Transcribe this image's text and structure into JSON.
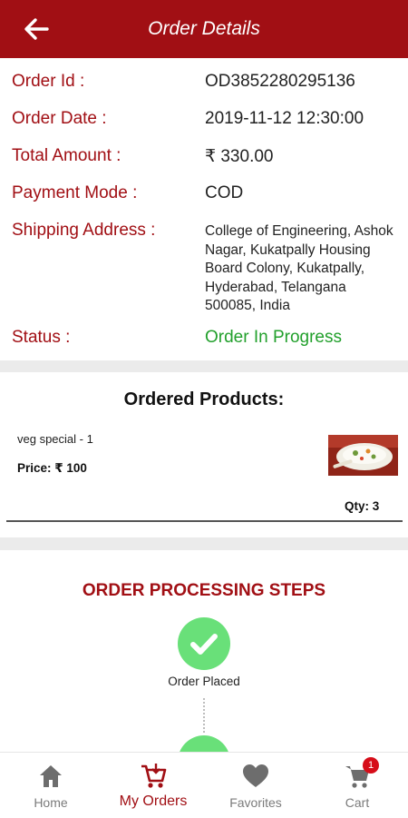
{
  "header": {
    "title": "Order Details"
  },
  "order": {
    "id_label": "Order Id :",
    "id_value": "OD3852280295136",
    "date_label": "Order Date :",
    "date_value": "2019-11-12 12:30:00",
    "amount_label": "Total Amount :",
    "amount_value": "₹ 330.00",
    "payment_label": "Payment Mode :",
    "payment_value": "COD",
    "address_label": "Shipping Address :",
    "address_value": "College of Engineering, Ashok Nagar, Kukatpally Housing Board Colony, Kukatpally, Hyderabad, Telangana 500085, India",
    "status_label": "Status :",
    "status_value": "Order In Progress"
  },
  "products": {
    "heading": "Ordered Products:",
    "items": [
      {
        "name": "veg special - 1",
        "price": "Price: ₹ 100",
        "qty": "Qty: 3"
      }
    ]
  },
  "steps": {
    "heading": "ORDER PROCESSING STEPS",
    "items": [
      {
        "label": "Order Placed"
      }
    ]
  },
  "bottom_nav": {
    "items": [
      {
        "label": "Home",
        "icon": "home-icon"
      },
      {
        "label": "My Orders",
        "icon": "orders-cart-icon"
      },
      {
        "label": "Favorites",
        "icon": "heart-icon"
      },
      {
        "label": "Cart",
        "icon": "cart-icon"
      }
    ],
    "cart_badge": "1"
  },
  "colors": {
    "brand": "#a10f14",
    "status_green": "#22a02c",
    "step_green": "#69e079",
    "badge_red": "#d60d19"
  }
}
